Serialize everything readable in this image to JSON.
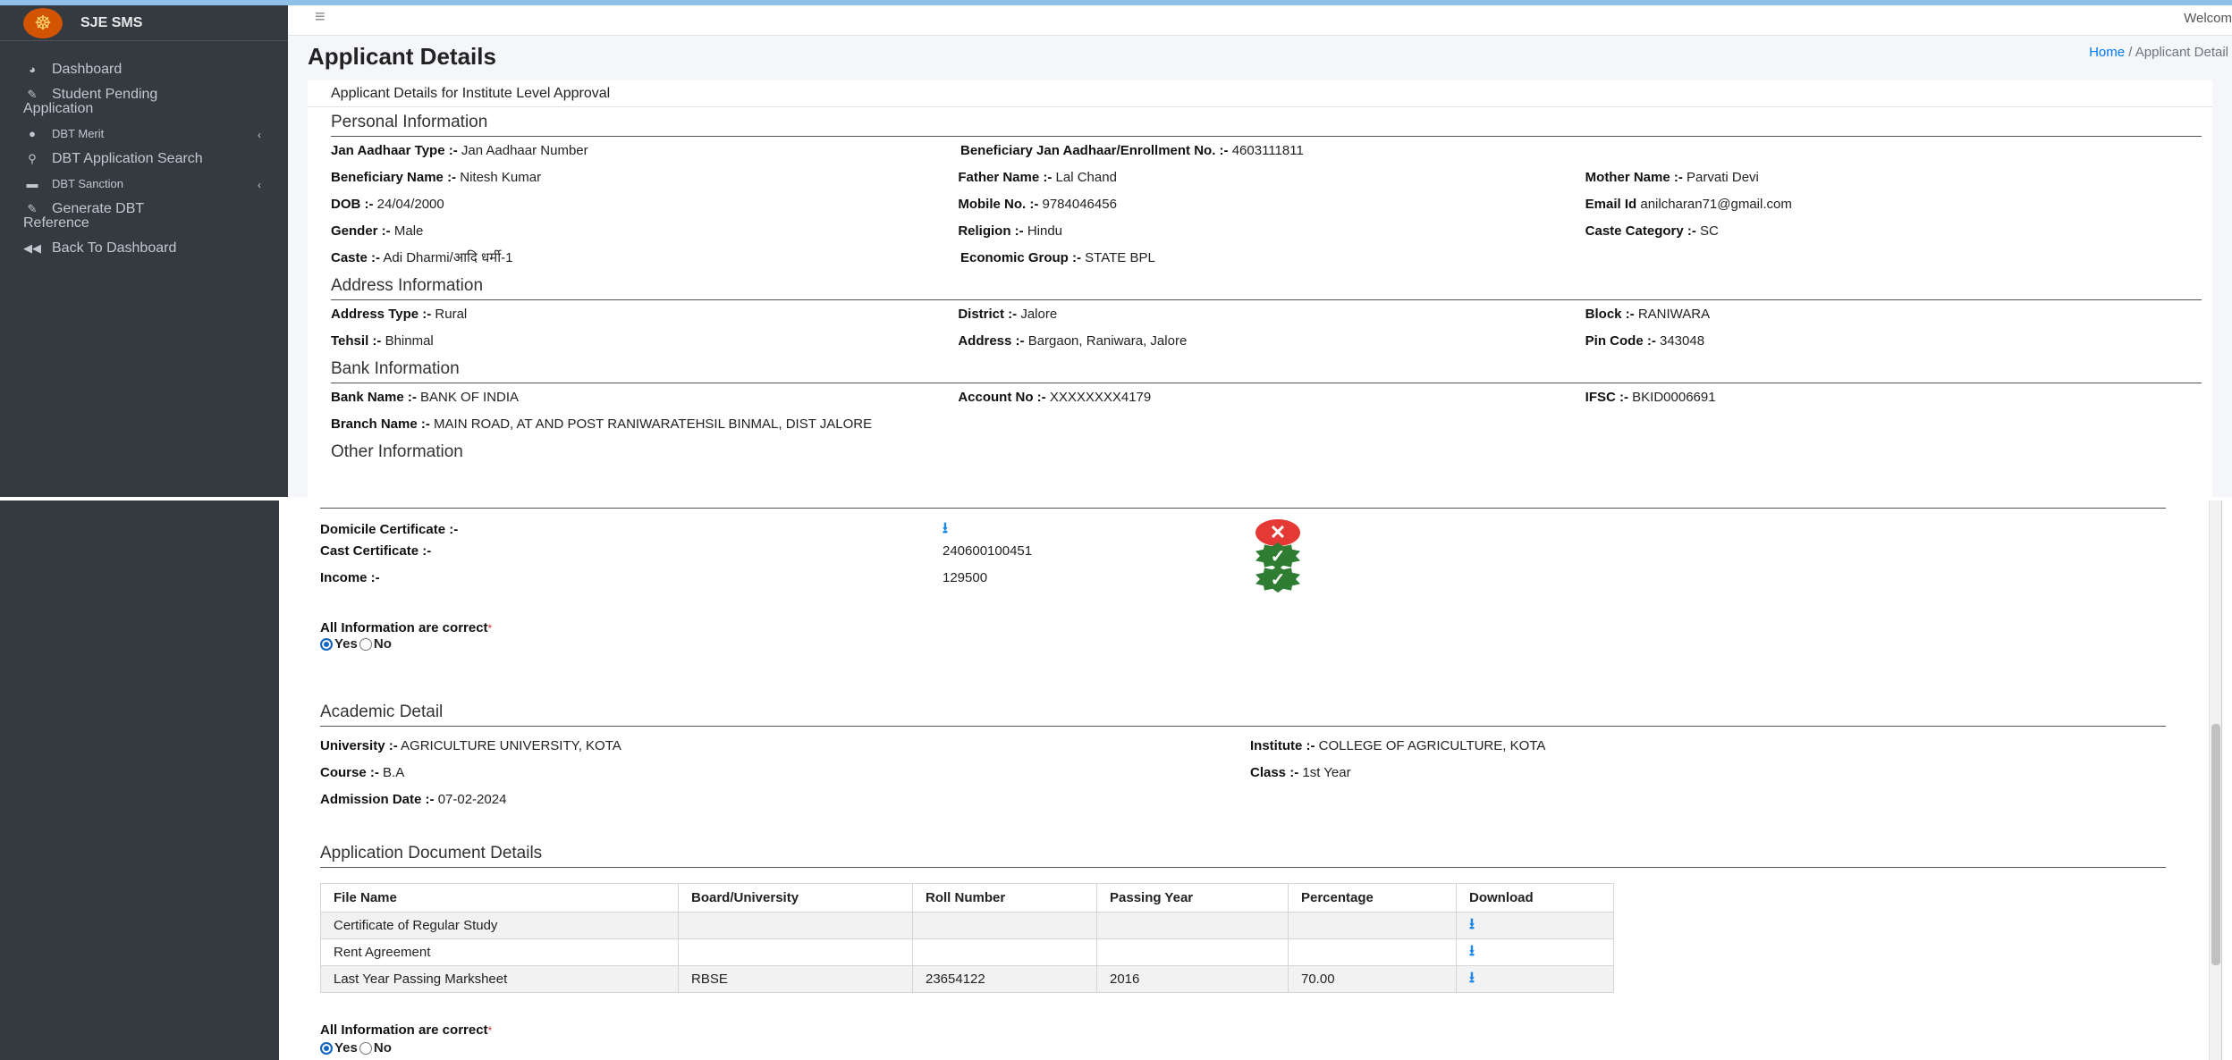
{
  "app": {
    "brand": "SJE SMS",
    "welcome": "Welcom"
  },
  "sidebar": {
    "items": [
      {
        "label": "Dashboard",
        "icon": "tachometer-icon"
      },
      {
        "label": "Student Pending Application",
        "icon": "edit-icon"
      },
      {
        "label": "DBT Merit",
        "icon": "circle-icon",
        "caret": "‹"
      },
      {
        "label": "DBT Application Search",
        "icon": "search-icon"
      },
      {
        "label": "DBT Sanction",
        "icon": "card-icon",
        "caret": "‹"
      },
      {
        "label": "Generate DBT Reference",
        "icon": "edit-icon"
      },
      {
        "label": "Back To Dashboard",
        "icon": "backward-icon"
      }
    ]
  },
  "page": {
    "title": "Applicant Details",
    "breadcrumb_home": "Home",
    "breadcrumb_sep": "/",
    "breadcrumb_current": "Applicant Detail",
    "card_header": "Applicant Details for Institute Level Approval"
  },
  "personal": {
    "title": "Personal Information",
    "jan_type_label": "Jan Aadhaar Type :-",
    "jan_type": "Jan Aadhaar Number",
    "jan_no_label": "Beneficiary Jan Aadhaar/Enrollment No. :-",
    "jan_no": "4603111811",
    "name_label": "Beneficiary Name :-",
    "name": "Nitesh Kumar",
    "father_label": "Father Name :-",
    "father": "Lal Chand",
    "mother_label": "Mother Name :-",
    "mother": "Parvati Devi",
    "dob_label": "DOB :-",
    "dob": "24/04/2000",
    "mobile_label": "Mobile No. :-",
    "mobile": "9784046456",
    "email_label": "Email Id",
    "email": "anilcharan71@gmail.com",
    "gender_label": "Gender :-",
    "gender": "Male",
    "religion_label": "Religion :-",
    "religion": "Hindu",
    "caste_cat_label": "Caste Category :-",
    "caste_cat": "SC",
    "caste_label": "Caste :-",
    "caste": "Adi Dharmi/आदि धर्मी-1",
    "econ_label": "Economic Group :-",
    "econ": "STATE BPL"
  },
  "address": {
    "title": "Address Information",
    "type_label": "Address Type :-",
    "type": "Rural",
    "district_label": "District :-",
    "district": "Jalore",
    "block_label": "Block :-",
    "block": "RANIWARA",
    "tehsil_label": "Tehsil :-",
    "tehsil": "Bhinmal",
    "address_label": "Address :-",
    "address": "Bargaon, Raniwara, Jalore",
    "pin_label": "Pin Code :-",
    "pin": "343048"
  },
  "bank": {
    "title": "Bank Information",
    "bank_label": "Bank Name :-",
    "bank": "BANK OF INDIA",
    "account_label": "Account No :-",
    "account": "XXXXXXXX4179",
    "ifsc_label": "IFSC :-",
    "ifsc": "BKID0006691",
    "branch_label": "Branch Name :-",
    "branch": "MAIN ROAD, AT AND POST RANIWARATEHSIL BINMAL, DIST JALORE"
  },
  "other": {
    "title": "Other Information",
    "domicile_label": "Domicile Certificate :-",
    "cast_label": "Cast Certificate :-",
    "cast_value": "240600100451",
    "income_label": "Income :-",
    "income_value": "129500",
    "confirm_label": "All Information are correct",
    "req": "*",
    "yes": "Yes",
    "no": "No"
  },
  "academic": {
    "title": "Academic Detail",
    "university_label": "University :-",
    "university": "AGRICULTURE UNIVERSITY, KOTA",
    "institute_label": "Institute :-",
    "institute": "COLLEGE OF AGRICULTURE, KOTA",
    "course_label": "Course :-",
    "course": "B.A",
    "class_label": "Class :-",
    "class": "1st Year",
    "admission_label": "Admission Date :-",
    "admission": "07-02-2024"
  },
  "documents": {
    "title": "Application Document Details",
    "headers": [
      "File Name",
      "Board/University",
      "Roll Number",
      "Passing Year",
      "Percentage",
      "Download"
    ],
    "rows": [
      {
        "file": "Certificate of Regular Study",
        "board": "",
        "roll": "",
        "year": "",
        "pct": ""
      },
      {
        "file": "Rent Agreement",
        "board": "",
        "roll": "",
        "year": "",
        "pct": ""
      },
      {
        "file": "Last Year Passing Marksheet",
        "board": "RBSE",
        "roll": "23654122",
        "year": "2016",
        "pct": "70.00"
      }
    ],
    "confirm_label": "All Information are correct",
    "req": "*",
    "yes": "Yes",
    "no": "No"
  },
  "colors": {
    "sidebar": "#343a40",
    "accent": "#007bff",
    "ok": "#2e7d32",
    "error": "#e53935"
  }
}
